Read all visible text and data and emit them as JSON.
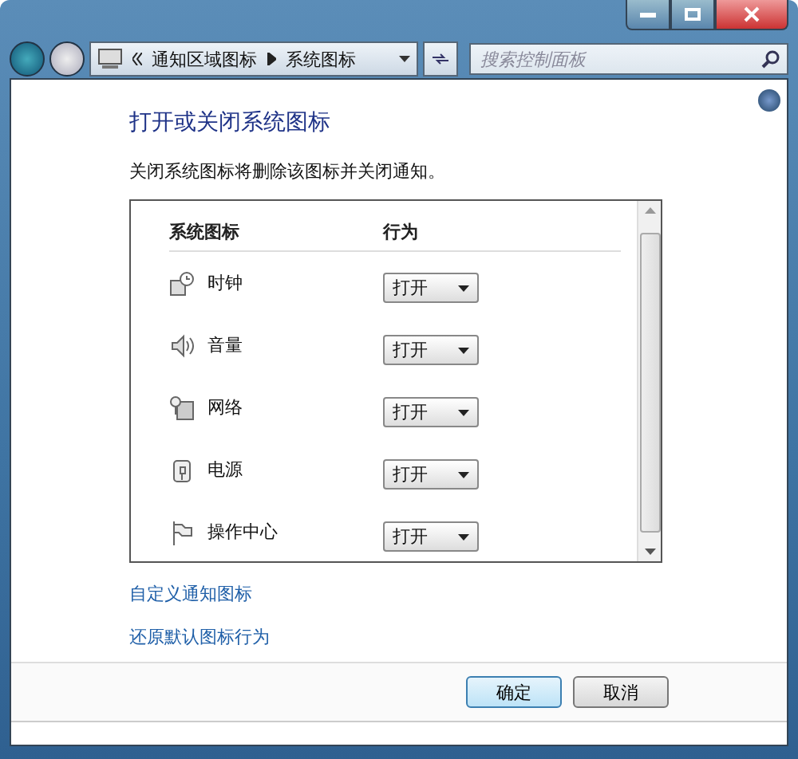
{
  "address_bar": {
    "crumbs": [
      "通知区域图标",
      "系统图标"
    ]
  },
  "search": {
    "placeholder": "搜索控制面板"
  },
  "heading": "打开或关闭系统图标",
  "description": "关闭系统图标将删除该图标并关闭通知。",
  "table": {
    "columns": [
      "系统图标",
      "行为"
    ],
    "rows": [
      {
        "name": "时钟",
        "value": "打开"
      },
      {
        "name": "音量",
        "value": "打开"
      },
      {
        "name": "网络",
        "value": "打开"
      },
      {
        "name": "电源",
        "value": "打开"
      },
      {
        "name": "操作中心",
        "value": "打开"
      }
    ]
  },
  "links": [
    "自定义通知图标",
    "还原默认图标行为"
  ],
  "buttons": [
    {
      "label": "确定",
      "default": true
    },
    {
      "label": "取消",
      "default": false
    }
  ]
}
